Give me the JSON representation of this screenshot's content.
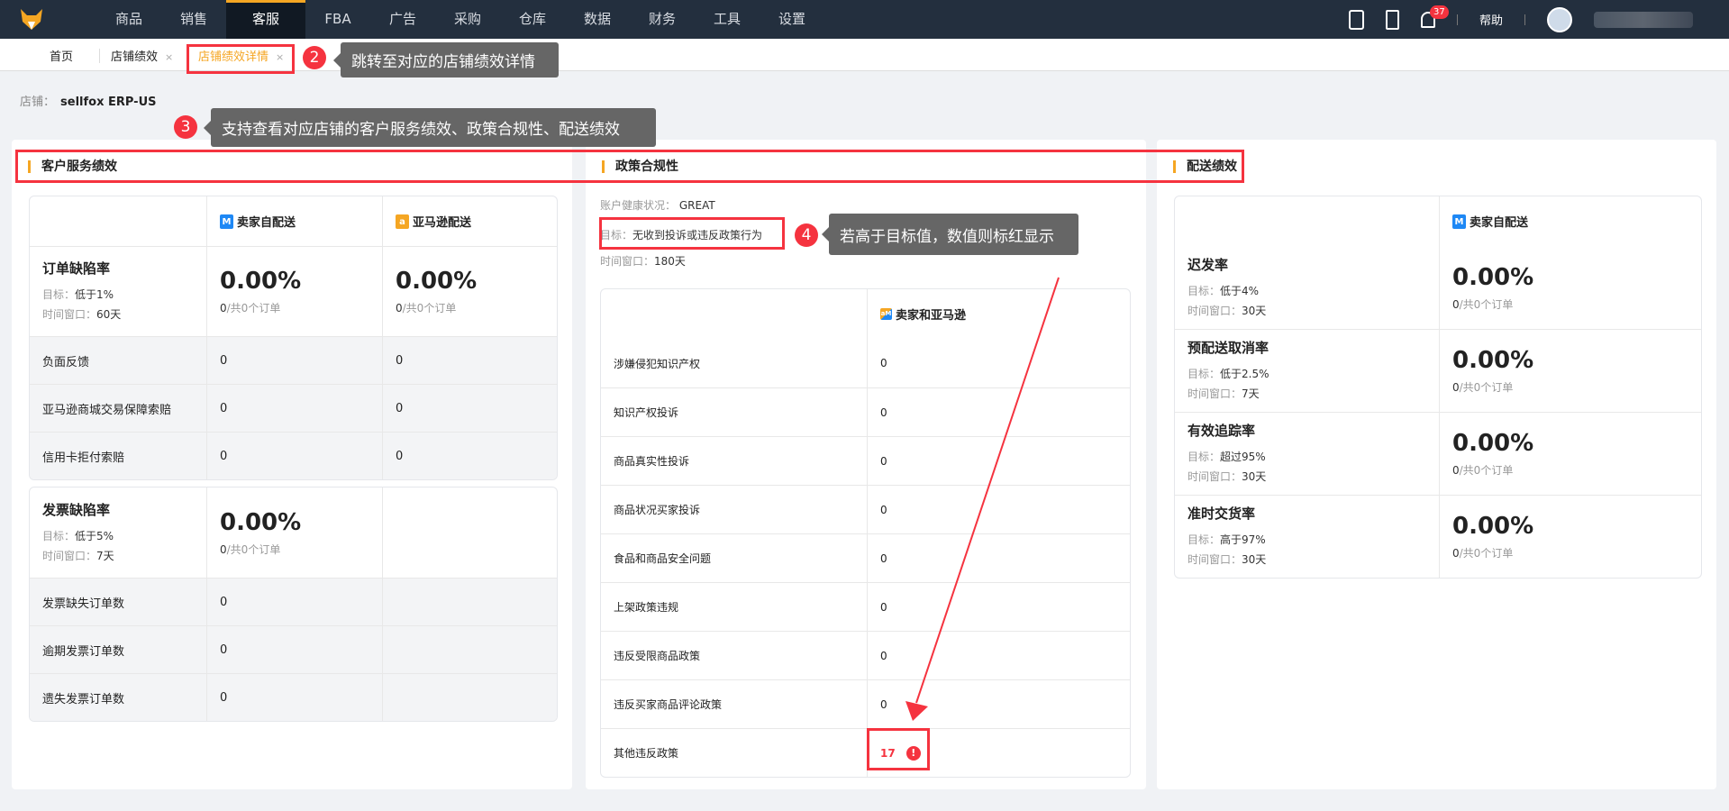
{
  "nav": {
    "menu": [
      "商品",
      "销售",
      "客服",
      "FBA",
      "广告",
      "采购",
      "仓库",
      "数据",
      "财务",
      "工具",
      "设置"
    ],
    "active_index": 2,
    "notification_count": "37",
    "help": "帮助"
  },
  "tabs": [
    {
      "label": "首页"
    },
    {
      "label": "店铺绩效",
      "close": "×"
    },
    {
      "label": "店铺绩效详情",
      "close": "×",
      "active": true
    }
  ],
  "store": {
    "label": "店铺：",
    "name": "sellfox ERP-US"
  },
  "annotations": {
    "n2": "2",
    "t2": "跳转至对应的店铺绩效详情",
    "n3": "3",
    "t3": "支持查看对应店铺的客户服务绩效、政策合规性、配送绩效",
    "n4": "4",
    "t4": "若高于目标值，数值则标红显示"
  },
  "customer_service": {
    "title": "客户服务绩效",
    "col1": "卖家自配送",
    "col2": "亚马逊配送",
    "odr": {
      "name": "订单缺陷率",
      "target_label": "目标：",
      "target": "低于1%",
      "window_label": "时间窗口：",
      "window": "60天",
      "v1": "0.00%",
      "o1": "0",
      "o1_rest": "/共0个订单",
      "v2": "0.00%",
      "o2": "0",
      "o2_rest": "/共0个订单"
    },
    "odr_rows": [
      {
        "label": "负面反馈",
        "v1": "0",
        "v2": "0"
      },
      {
        "label": "亚马逊商城交易保障索赔",
        "v1": "0",
        "v2": "0"
      },
      {
        "label": "信用卡拒付索赔",
        "v1": "0",
        "v2": "0"
      }
    ],
    "invoice": {
      "name": "发票缺陷率",
      "target_label": "目标：",
      "target": "低于5%",
      "window_label": "时间窗口：",
      "window": "7天",
      "v1": "0.00%",
      "o1": "0",
      "o1_rest": "/共0个订单"
    },
    "invoice_rows": [
      {
        "label": "发票缺失订单数",
        "v1": "0"
      },
      {
        "label": "逾期发票订单数",
        "v1": "0"
      },
      {
        "label": "遗失发票订单数",
        "v1": "0"
      }
    ]
  },
  "policy": {
    "title": "政策合规性",
    "health_label": "账户健康状况：",
    "health": "GREAT",
    "target_label": "目标：",
    "target": "无收到投诉或违反政策行为",
    "window_label": "时间窗口：",
    "window": "180天",
    "col": "卖家和亚马逊",
    "rows": [
      {
        "label": "涉嫌侵犯知识产权",
        "v": "0"
      },
      {
        "label": "知识产权投诉",
        "v": "0"
      },
      {
        "label": "商品真实性投诉",
        "v": "0"
      },
      {
        "label": "商品状况买家投诉",
        "v": "0"
      },
      {
        "label": "食品和商品安全问题",
        "v": "0"
      },
      {
        "label": "上架政策违规",
        "v": "0"
      },
      {
        "label": "违反受限商品政策",
        "v": "0"
      },
      {
        "label": "违反买家商品评论政策",
        "v": "0"
      },
      {
        "label": "其他违反政策",
        "v": "17",
        "alert": true
      }
    ]
  },
  "delivery": {
    "title": "配送绩效",
    "col": "卖家自配送",
    "rows": [
      {
        "name": "迟发率",
        "target_label": "目标：",
        "target": "低于4%",
        "window_label": "时间窗口：",
        "window": "30天",
        "v": "0.00%",
        "o": "0",
        "o_rest": "/共0个订单"
      },
      {
        "name": "预配送取消率",
        "target_label": "目标：",
        "target": "低于2.5%",
        "window_label": "时间窗口：",
        "window": "7天",
        "v": "0.00%",
        "o": "0",
        "o_rest": "/共0个订单"
      },
      {
        "name": "有效追踪率",
        "target_label": "目标：",
        "target": "超过95%",
        "window_label": "时间窗口：",
        "window": "30天",
        "v": "0.00%",
        "o": "0",
        "o_rest": "/共0个订单"
      },
      {
        "name": "准时交货率",
        "target_label": "目标：",
        "target": "高于97%",
        "window_label": "时间窗口：",
        "window": "30天",
        "v": "0.00%",
        "o": "0",
        "o_rest": "/共0个订单"
      }
    ]
  }
}
